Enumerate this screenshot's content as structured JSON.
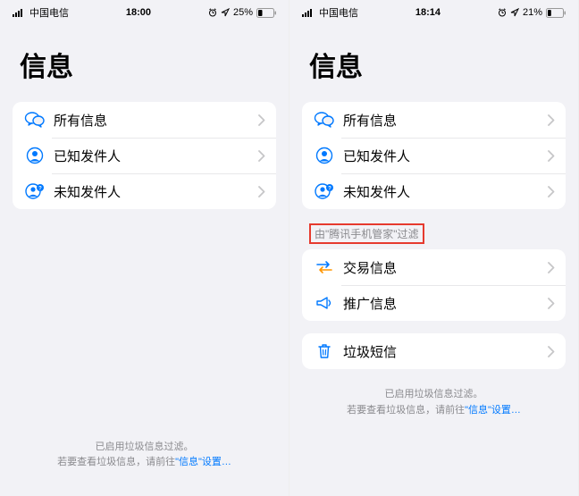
{
  "left": {
    "status": {
      "carrier": "中国电信",
      "time": "18:00",
      "battery": "25%"
    },
    "title": "信息",
    "group1": [
      {
        "icon": "chat",
        "label": "所有信息"
      },
      {
        "icon": "person-known",
        "label": "已知发件人"
      },
      {
        "icon": "person-unknown",
        "label": "未知发件人"
      }
    ],
    "footer": {
      "line1": "已启用垃圾信息过滤。",
      "line2a": "若要查看垃圾信息，请前往",
      "link": "\"信息\"设置…"
    }
  },
  "right": {
    "status": {
      "carrier": "中国电信",
      "time": "18:14",
      "battery": "21%"
    },
    "title": "信息",
    "group1": [
      {
        "icon": "chat",
        "label": "所有信息"
      },
      {
        "icon": "person-known",
        "label": "已知发件人"
      },
      {
        "icon": "person-unknown",
        "label": "未知发件人"
      }
    ],
    "filter_header": "由\"腾讯手机管家\"过滤",
    "group2": [
      {
        "icon": "transfer",
        "label": "交易信息"
      },
      {
        "icon": "megaphone",
        "label": "推广信息"
      }
    ],
    "group3": [
      {
        "icon": "trash",
        "label": "垃圾短信"
      }
    ],
    "footer": {
      "line1": "已启用垃圾信息过滤。",
      "line2a": "若要查看垃圾信息，请前往",
      "link": "\"信息\"设置…"
    }
  }
}
